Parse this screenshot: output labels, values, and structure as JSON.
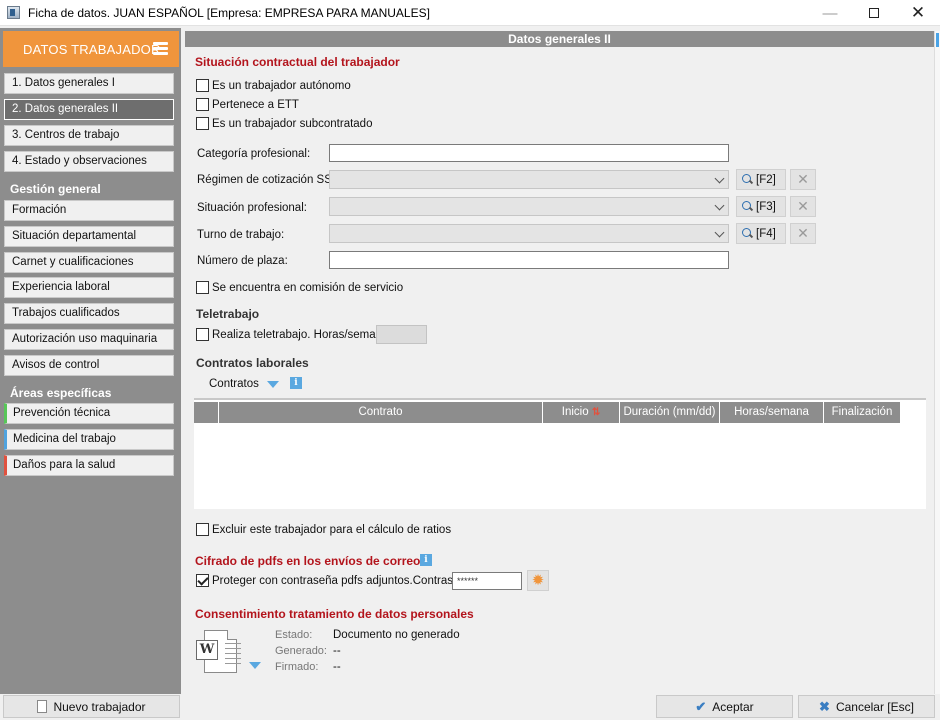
{
  "window": {
    "title": "Ficha de datos. JUAN ESPAÑOL  [Empresa: EMPRESA PARA MANUALES]",
    "minimize_label": "—",
    "close_label": "✕"
  },
  "sidebar": {
    "header": "DATOS TRABAJADOR",
    "items": [
      {
        "label": "1. Datos generales I"
      },
      {
        "label": "2. Datos generales II",
        "active": true
      },
      {
        "label": "3. Centros de trabajo"
      },
      {
        "label": "4. Estado y observaciones"
      }
    ],
    "section_general": "Gestión general",
    "general_items": [
      {
        "label": "Formación"
      },
      {
        "label": "Situación departamental"
      },
      {
        "label": "Carnet y cualificaciones"
      },
      {
        "label": "Experiencia laboral"
      },
      {
        "label": "Trabajos cualificados"
      },
      {
        "label": "Autorización uso maquinaria"
      },
      {
        "label": "Avisos de control"
      }
    ],
    "section_specific": "Áreas específicas",
    "specific_items": [
      {
        "label": "Prevención técnica",
        "color": "#58c658"
      },
      {
        "label": "Medicina del trabajo",
        "color": "#4fa3df"
      },
      {
        "label": "Daños para la salud",
        "color": "#e0523f"
      }
    ]
  },
  "main": {
    "header": "Datos generales II",
    "contract_section": "Situación contractual del trabajador",
    "checkboxes": {
      "autonomo": {
        "label": "Es un trabajador autónomo",
        "checked": false
      },
      "ett": {
        "label": "Pertenece a ETT",
        "checked": false
      },
      "subcontratado": {
        "label": "Es un trabajador subcontratado",
        "checked": false
      }
    },
    "fields": {
      "categoria": {
        "label": "Categoría profesional:",
        "value": ""
      },
      "regimen": {
        "label": "Régimen de cotización SS:",
        "value": "",
        "shortcut": "[F2]"
      },
      "situacion": {
        "label": "Situación profesional:",
        "value": "",
        "shortcut": "[F3]"
      },
      "turno": {
        "label": "Turno de trabajo:",
        "value": "",
        "shortcut": "[F4]"
      },
      "plaza": {
        "label": "Número de plaza:",
        "value": ""
      }
    },
    "comision": {
      "label": "Se encuentra en comisión de servicio",
      "checked": false
    },
    "teletrabajo": {
      "title": "Teletrabajo",
      "label": "Realiza teletrabajo. Horas/semana:",
      "checked": false,
      "hours": ""
    },
    "contratos": {
      "title": "Contratos laborales",
      "dropdown_label": "Contratos",
      "columns": [
        "",
        "Contrato",
        "Inicio",
        "Duración (mm/dd)",
        "Horas/semana",
        "Finalización"
      ],
      "rows": []
    },
    "excluir": {
      "label": "Excluir este trabajador para el cálculo de ratios",
      "checked": false
    },
    "cifrado": {
      "title": "Cifrado de pdfs en los envíos de correo",
      "label": "Proteger con contraseña pdfs adjuntos.Contraseña:",
      "checked": true,
      "password": "******"
    },
    "consentimiento": {
      "title": "Consentimiento tratamiento de datos personales",
      "estado_label": "Estado:",
      "estado_value": "Documento no generado",
      "generado_label": "Generado:",
      "generado_value": "--",
      "firmado_label": "Firmado:",
      "firmado_value": "--"
    }
  },
  "footer": {
    "new_worker": "Nuevo trabajador",
    "accept": "Aceptar",
    "cancel": "Cancelar  [Esc]"
  },
  "colors": {
    "accent": "#f0953c",
    "section_title": "#b3141c",
    "sidebar_bg": "#8d8d8d"
  }
}
